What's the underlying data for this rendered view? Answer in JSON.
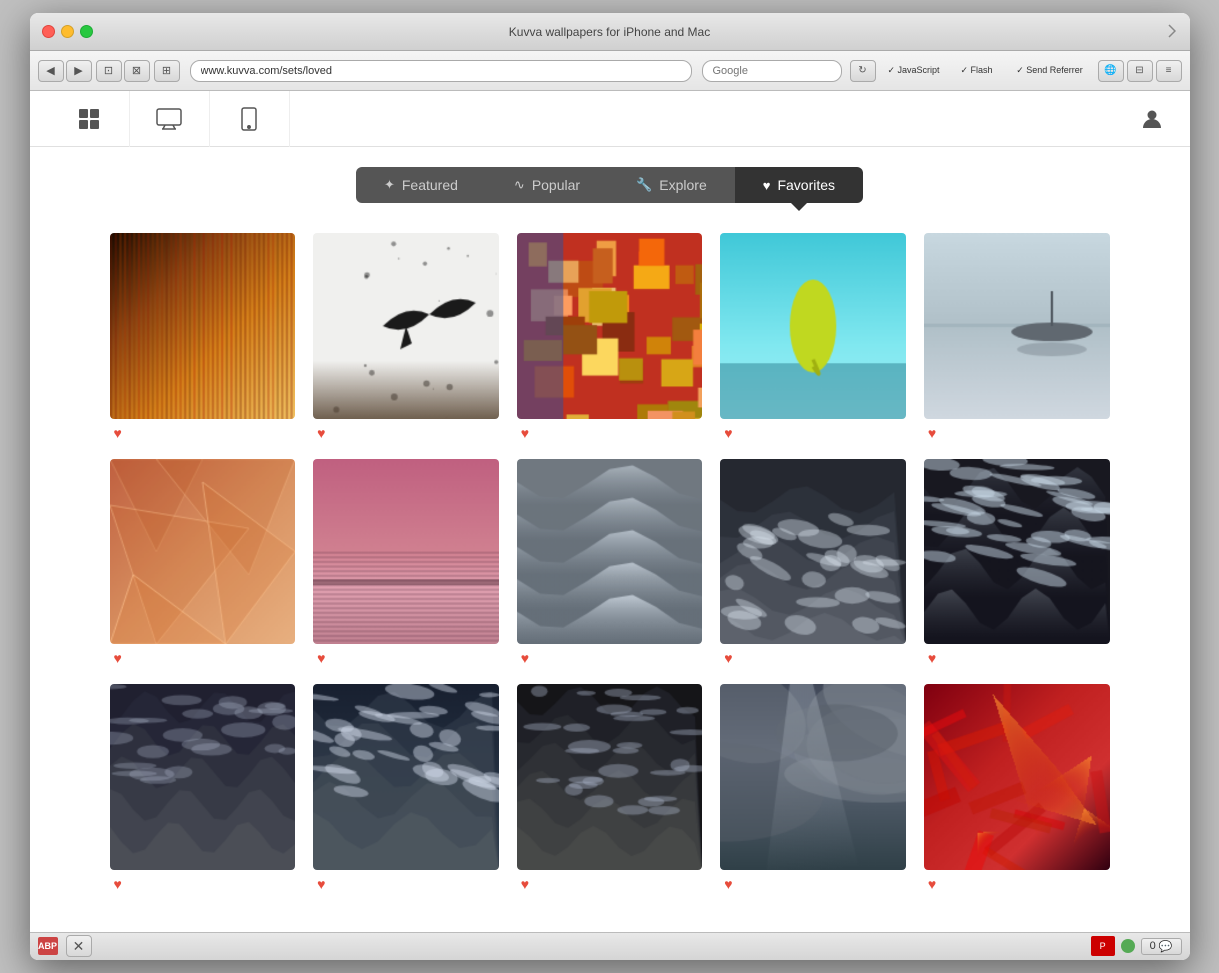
{
  "browser": {
    "title": "Kuvva wallpapers for iPhone and Mac",
    "address": "www.kuvva.com/sets/loved",
    "search_placeholder": "Google",
    "traffic_lights": [
      "red",
      "yellow",
      "green"
    ]
  },
  "nav": {
    "icons": [
      {
        "name": "grid",
        "symbol": "⊞",
        "active": false
      },
      {
        "name": "monitor",
        "symbol": "🖥",
        "active": false
      },
      {
        "name": "phone",
        "symbol": "📱",
        "active": false
      }
    ],
    "user_icon": "👤"
  },
  "tabs": [
    {
      "id": "featured",
      "label": "Featured",
      "icon": "✦",
      "active": false
    },
    {
      "id": "popular",
      "label": "Popular",
      "icon": "∿",
      "active": false
    },
    {
      "id": "explore",
      "label": "Explore",
      "icon": "🔧",
      "active": false
    },
    {
      "id": "favorites",
      "label": "Favorites",
      "icon": "♥",
      "active": true
    }
  ],
  "images": [
    {
      "id": 1,
      "type": "abstract_warm",
      "colors": [
        "#c8832a",
        "#e6c060",
        "#2b1a05",
        "#8b5e1a",
        "#f0d080"
      ],
      "description": "Warm vertical blur cityscape",
      "heart": true
    },
    {
      "id": 2,
      "type": "bird_minimal",
      "colors": [
        "#e8e8e8",
        "#f2f2f2",
        "#2a2a2a",
        "#d0d0d0"
      ],
      "description": "Black bird on white background",
      "heart": true
    },
    {
      "id": 3,
      "type": "city_aerial",
      "colors": [
        "#c43020",
        "#e85030",
        "#f07040",
        "#3040a0",
        "#80a0c0"
      ],
      "description": "Colorful aerial city view",
      "heart": true
    },
    {
      "id": 4,
      "type": "water_drop",
      "colors": [
        "#50c8d0",
        "#80e0e8",
        "#a0eef0",
        "#c0d820",
        "#f0f8a0"
      ],
      "description": "Water drop on blue background",
      "heart": true
    },
    {
      "id": 5,
      "type": "boat_misty",
      "colors": [
        "#b0b8c0",
        "#c8d0d8",
        "#d8e0e8",
        "#90a0a8",
        "#607080"
      ],
      "description": "Boat in misty water",
      "heart": true
    },
    {
      "id": 6,
      "type": "geometric_warm",
      "colors": [
        "#c06040",
        "#d08060",
        "#e0a080",
        "#f0c0a0",
        "#b05030"
      ],
      "description": "Warm geometric triangles",
      "heart": true
    },
    {
      "id": 7,
      "type": "sunset_blur",
      "colors": [
        "#c06080",
        "#d080a0",
        "#e8a0c0",
        "#f0c0d8",
        "#805060"
      ],
      "description": "Blurred sunset landscape",
      "heart": true
    },
    {
      "id": 8,
      "type": "stormy_waves",
      "colors": [
        "#606870",
        "#808890",
        "#a0a8b0",
        "#c0c8d0",
        "#505860"
      ],
      "description": "Dark stormy waves",
      "heart": true
    },
    {
      "id": 9,
      "type": "dark_waves",
      "colors": [
        "#303840",
        "#404850",
        "#505860",
        "#607080",
        "#202830"
      ],
      "description": "Dark ocean waves",
      "heart": true
    },
    {
      "id": 10,
      "type": "crashing_waves",
      "colors": [
        "#202828",
        "#303838",
        "#404848",
        "#505858",
        "#181820"
      ],
      "description": "Crashing dark waves",
      "heart": true
    },
    {
      "id": 11,
      "type": "wave_dark",
      "colors": [
        "#303040",
        "#404050",
        "#505060",
        "#202030",
        "#606070"
      ],
      "description": "Dark wave close up",
      "heart": true
    },
    {
      "id": 12,
      "type": "wave_spray",
      "colors": [
        "#283040",
        "#384050",
        "#485060",
        "#182030",
        "#586070"
      ],
      "description": "Wave with spray",
      "heart": true
    },
    {
      "id": 13,
      "type": "storm_dark",
      "colors": [
        "#252528",
        "#353538",
        "#454548",
        "#151518",
        "#555558"
      ],
      "description": "Dark storm waves",
      "heart": true
    },
    {
      "id": 14,
      "type": "clouds_dramatic",
      "colors": [
        "#505868",
        "#606878",
        "#707888",
        "#404858",
        "#303848"
      ],
      "description": "Dramatic storm clouds",
      "heart": true
    },
    {
      "id": 15,
      "type": "red_abstract",
      "colors": [
        "#c02020",
        "#d03030",
        "#802020",
        "#e04040",
        "#400010"
      ],
      "description": "Red abstract dramatic",
      "heart": true
    }
  ],
  "bottom_bar": {
    "abp_label": "ABP",
    "counter": "0"
  }
}
